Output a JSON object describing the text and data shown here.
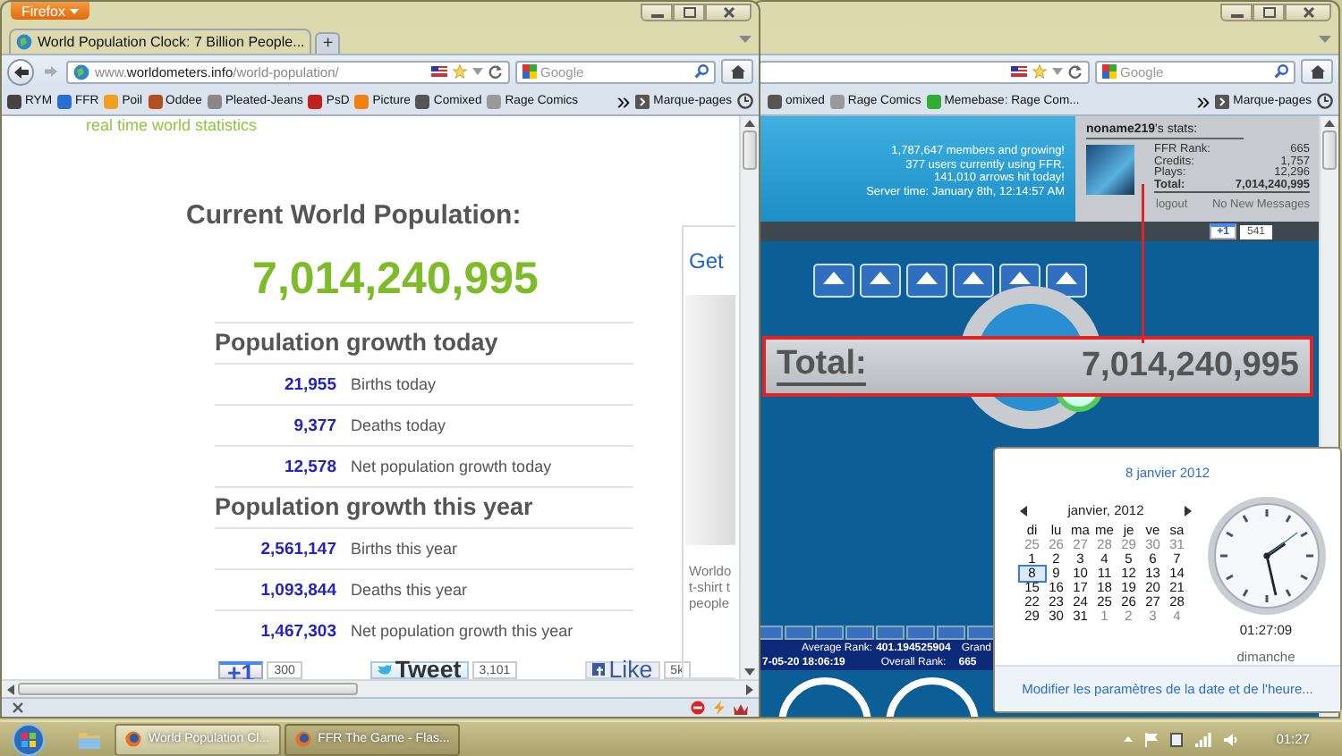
{
  "left_window": {
    "firefox_button": "Firefox",
    "tab": {
      "title": "World Population Clock: 7 Billion People..."
    },
    "new_tab": "+",
    "address": "www.**worldometers.info**/world-population/",
    "search_placeholder": "Google",
    "bookmarks": [
      "RYM",
      "FFR",
      "Poil",
      "Oddee",
      "Pleated-Jeans",
      "PsD",
      "Picture",
      "Comixed",
      "Rage Comics"
    ],
    "bookmarks_more": "»",
    "bookmarks_menu": "Marque-pages",
    "page": {
      "tagline": "real time world statistics",
      "heading": "Current World Population:",
      "population": "7,014,240,995",
      "sections": [
        {
          "title": "Population growth today",
          "rows": [
            {
              "value": "21,955",
              "label": "Births today"
            },
            {
              "value": "9,377",
              "label": "Deaths today"
            },
            {
              "value": "12,578",
              "label": "Net population growth today"
            }
          ]
        },
        {
          "title": "Population growth this year",
          "rows": [
            {
              "value": "2,561,147",
              "label": "Births this year"
            },
            {
              "value": "1,093,844",
              "label": "Deaths this year"
            },
            {
              "value": "1,467,303",
              "label": "Net population growth this year"
            }
          ]
        }
      ],
      "ad": {
        "link": "Get",
        "lines": [
          "Worldo",
          "t-shirt t",
          "people"
        ]
      },
      "social": [
        {
          "kind": "plusone",
          "label": "+1",
          "count": "300"
        },
        {
          "kind": "tweet",
          "label": "Tweet",
          "count": "3,101"
        },
        {
          "kind": "like",
          "label": "Like",
          "count": "5k"
        }
      ]
    }
  },
  "right_window": {
    "search_placeholder": "Google",
    "bookmarks": [
      "omixed",
      "Rage Comics",
      "Memebase: Rage Com..."
    ],
    "bookmarks_more": "»",
    "bookmarks_menu": "Marque-pages",
    "site": {
      "stats_lines": [
        "1,787,647 members and growing!",
        "377 users currently using FFR.",
        "141,010 arrows hit today!",
        "Server time: January 8th, 12:14:57 AM"
      ],
      "user_title": "**noname219**'s stats:",
      "stats": [
        {
          "label": "FFR Rank:",
          "value": "665"
        },
        {
          "label": "Credits:",
          "value": "1,757"
        },
        {
          "label": "Plays:",
          "value": "12,296"
        },
        {
          "label": "Total:",
          "value": "7,014,240,995"
        }
      ],
      "logout": "logout",
      "messages": "No New Messages",
      "plus_one": "+1",
      "plus_count": "541",
      "highlight": {
        "label": "Total:",
        "value": "7,014,240,995"
      },
      "game": {
        "average_rank_label": "Average Rank:",
        "average_rank": "401.194525904",
        "grand_label": "Grand",
        "date": "7-05-20 18:06:19",
        "overall_rank_label": "Overall Rank:",
        "overall_rank": "665"
      }
    }
  },
  "calendar": {
    "date_title": "8 janvier 2012",
    "month_label": "janvier, 2012",
    "weekdays": [
      "di",
      "lu",
      "ma",
      "me",
      "je",
      "ve",
      "sa"
    ],
    "days": [
      {
        "label": "25",
        "current_month": false,
        "selected": false
      },
      {
        "label": "26",
        "current_month": false,
        "selected": false
      },
      {
        "label": "27",
        "current_month": false,
        "selected": false
      },
      {
        "label": "28",
        "current_month": false,
        "selected": false
      },
      {
        "label": "29",
        "current_month": false,
        "selected": false
      },
      {
        "label": "30",
        "current_month": false,
        "selected": false
      },
      {
        "label": "31",
        "current_month": false,
        "selected": false
      },
      {
        "label": "1",
        "current_month": true,
        "selected": false
      },
      {
        "label": "2",
        "current_month": true,
        "selected": false
      },
      {
        "label": "3",
        "current_month": true,
        "selected": false
      },
      {
        "label": "4",
        "current_month": true,
        "selected": false
      },
      {
        "label": "5",
        "current_month": true,
        "selected": false
      },
      {
        "label": "6",
        "current_month": true,
        "selected": false
      },
      {
        "label": "7",
        "current_month": true,
        "selected": false
      },
      {
        "label": "8",
        "current_month": true,
        "selected": true
      },
      {
        "label": "9",
        "current_month": true,
        "selected": false
      },
      {
        "label": "10",
        "current_month": true,
        "selected": false
      },
      {
        "label": "11",
        "current_month": true,
        "selected": false
      },
      {
        "label": "12",
        "current_month": true,
        "selected": false
      },
      {
        "label": "13",
        "current_month": true,
        "selected": false
      },
      {
        "label": "14",
        "current_month": true,
        "selected": false
      },
      {
        "label": "15",
        "current_month": true,
        "selected": false
      },
      {
        "label": "16",
        "current_month": true,
        "selected": false
      },
      {
        "label": "17",
        "current_month": true,
        "selected": false
      },
      {
        "label": "18",
        "current_month": true,
        "selected": false
      },
      {
        "label": "19",
        "current_month": true,
        "selected": false
      },
      {
        "label": "20",
        "current_month": true,
        "selected": false
      },
      {
        "label": "21",
        "current_month": true,
        "selected": false
      },
      {
        "label": "22",
        "current_month": true,
        "selected": false
      },
      {
        "label": "23",
        "current_month": true,
        "selected": false
      },
      {
        "label": "24",
        "current_month": true,
        "selected": false
      },
      {
        "label": "25",
        "current_month": true,
        "selected": false
      },
      {
        "label": "26",
        "current_month": true,
        "selected": false
      },
      {
        "label": "27",
        "current_month": true,
        "selected": false
      },
      {
        "label": "28",
        "current_month": true,
        "selected": false
      },
      {
        "label": "29",
        "current_month": true,
        "selected": false
      },
      {
        "label": "30",
        "current_month": true,
        "selected": false
      },
      {
        "label": "31",
        "current_month": true,
        "selected": false
      },
      {
        "label": "1",
        "current_month": false,
        "selected": false
      },
      {
        "label": "2",
        "current_month": false,
        "selected": false
      },
      {
        "label": "3",
        "current_month": false,
        "selected": false
      },
      {
        "label": "4",
        "current_month": false,
        "selected": false
      }
    ],
    "time": "01:27:09",
    "weekday_name": "dimanche",
    "settings_link": "Modifier les paramètres de la date et de l'heure..."
  },
  "taskbar": {
    "buttons": [
      {
        "label": "World Population Cl...",
        "selected": true
      },
      {
        "label": "FFR The Game - Flas...",
        "selected": false
      }
    ],
    "clock": "01:27"
  }
}
